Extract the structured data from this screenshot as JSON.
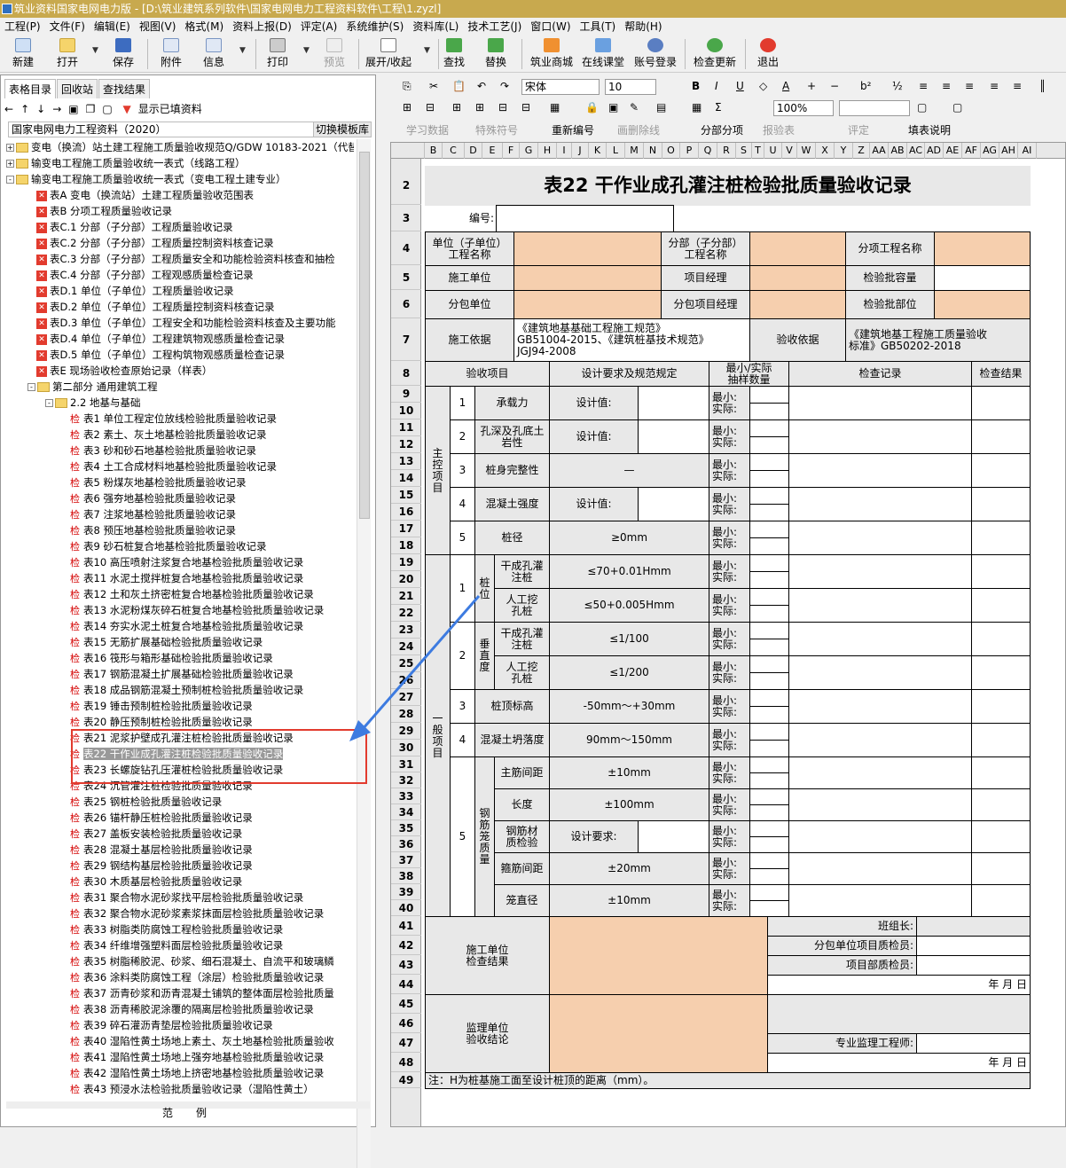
{
  "window": {
    "title": "筑业资料国家电网电力版 - [D:\\筑业建筑系列软件\\国家电网电力工程资料软件\\工程\\1.zyzl]"
  },
  "menu": [
    "工程(P)",
    "文件(F)",
    "编辑(E)",
    "视图(V)",
    "格式(M)",
    "资料上报(D)",
    "评定(A)",
    "系统维护(S)",
    "资料库(L)",
    "技术工艺(J)",
    "窗口(W)",
    "工具(T)",
    "帮助(H)"
  ],
  "toolbar": {
    "new": "新建",
    "open": "打开",
    "save": "保存",
    "attach": "附件",
    "info": "信息",
    "print": "打印",
    "preview": "预览",
    "expand": "展开/收起",
    "search": "查找",
    "replace": "替换",
    "mall": "筑业商城",
    "classroom": "在线课堂",
    "login": "账号登录",
    "update": "检查更新",
    "exit": "退出"
  },
  "left": {
    "tabs": [
      "表格目录",
      "回收站",
      "查找结果"
    ],
    "show_filled": "显示已填资料",
    "project": "国家电网电力工程资料（2020）",
    "switch_template": "切换模板库",
    "bottom": "范例"
  },
  "tree": [
    {
      "lv": 0,
      "t": "f",
      "ex": "+",
      "label": "变电（换流）站土建工程施工质量验收规范Q/GDW 10183-2021（代替"
    },
    {
      "lv": 0,
      "t": "f",
      "ex": "+",
      "label": "输变电工程施工质量验收统一表式（线路工程）"
    },
    {
      "lv": 0,
      "t": "f",
      "ex": "-",
      "label": "输变电工程施工质量验收统一表式（变电工程土建专业）"
    },
    {
      "lv": 1,
      "t": "x",
      "label": "表A 变电（换流站）土建工程质量验收范围表"
    },
    {
      "lv": 1,
      "t": "x",
      "label": "表B 分项工程质量验收记录"
    },
    {
      "lv": 1,
      "t": "x",
      "label": "表C.1 分部（子分部）工程质量验收记录"
    },
    {
      "lv": 1,
      "t": "x",
      "label": "表C.2 分部（子分部）工程质量控制资料核查记录"
    },
    {
      "lv": 1,
      "t": "x",
      "label": "表C.3 分部（子分部）工程质量安全和功能检验资料核查和抽检"
    },
    {
      "lv": 1,
      "t": "x",
      "label": "表C.4 分部（子分部）工程观感质量检查记录"
    },
    {
      "lv": 1,
      "t": "x",
      "label": "表D.1 单位（子单位）工程质量验收记录"
    },
    {
      "lv": 1,
      "t": "x",
      "label": "表D.2 单位（子单位）工程质量控制资料核查记录"
    },
    {
      "lv": 1,
      "t": "x",
      "label": "表D.3 单位（子单位）工程安全和功能检验资料核查及主要功能"
    },
    {
      "lv": 1,
      "t": "x",
      "label": "表D.4 单位（子单位）工程建筑物观感质量检查记录"
    },
    {
      "lv": 1,
      "t": "x",
      "label": "表D.5 单位（子单位）工程构筑物观感质量检查记录"
    },
    {
      "lv": 1,
      "t": "x",
      "label": "表E 现场验收检查原始记录（样表）"
    },
    {
      "lv": 1,
      "t": "f",
      "ex": "-",
      "label": "第二部分 通用建筑工程"
    },
    {
      "lv": 2,
      "t": "f",
      "ex": "-",
      "label": "2.2 地基与基础"
    },
    {
      "lv": 3,
      "t": "j",
      "label": "表1 单位工程定位放线检验批质量验收记录"
    },
    {
      "lv": 3,
      "t": "j",
      "label": "表2 素土、灰土地基检验批质量验收记录"
    },
    {
      "lv": 3,
      "t": "j",
      "label": "表3 砂和砂石地基检验批质量验收记录"
    },
    {
      "lv": 3,
      "t": "j",
      "label": "表4 土工合成材料地基检验批质量验收记录"
    },
    {
      "lv": 3,
      "t": "j",
      "label": "表5 粉煤灰地基检验批质量验收记录"
    },
    {
      "lv": 3,
      "t": "j",
      "label": "表6 强夯地基检验批质量验收记录"
    },
    {
      "lv": 3,
      "t": "j",
      "label": "表7 注浆地基检验批质量验收记录"
    },
    {
      "lv": 3,
      "t": "j",
      "label": "表8 预压地基检验批质量验收记录"
    },
    {
      "lv": 3,
      "t": "j",
      "label": "表9 砂石桩复合地基检验批质量验收记录"
    },
    {
      "lv": 3,
      "t": "j",
      "label": "表10 高压喷射注浆复合地基检验批质量验收记录"
    },
    {
      "lv": 3,
      "t": "j",
      "label": "表11 水泥土搅拌桩复合地基检验批质量验收记录"
    },
    {
      "lv": 3,
      "t": "j",
      "label": "表12 土和灰土挤密桩复合地基检验批质量验收记录"
    },
    {
      "lv": 3,
      "t": "j",
      "label": "表13 水泥粉煤灰碎石桩复合地基检验批质量验收记录"
    },
    {
      "lv": 3,
      "t": "j",
      "label": "表14 夯实水泥土桩复合地基检验批质量验收记录"
    },
    {
      "lv": 3,
      "t": "j",
      "label": "表15 无筋扩展基础检验批质量验收记录"
    },
    {
      "lv": 3,
      "t": "j",
      "label": "表16 筏形与箱形基础检验批质量验收记录"
    },
    {
      "lv": 3,
      "t": "j",
      "label": "表17 钢筋混凝土扩展基础检验批质量验收记录"
    },
    {
      "lv": 3,
      "t": "j",
      "label": "表18 成品钢筋混凝土预制桩检验批质量验收记录"
    },
    {
      "lv": 3,
      "t": "j",
      "label": "表19 锤击预制桩检验批质量验收记录"
    },
    {
      "lv": 3,
      "t": "j",
      "label": "表20 静压预制桩检验批质量验收记录"
    },
    {
      "lv": 3,
      "t": "j",
      "label": "表21 泥浆护壁成孔灌注桩检验批质量验收记录"
    },
    {
      "lv": 3,
      "t": "j",
      "sel": true,
      "label": "表22 干作业成孔灌注桩检验批质量验收记录"
    },
    {
      "lv": 3,
      "t": "j",
      "label": "表23 长螺旋钻孔压灌桩检验批质量验收记录"
    },
    {
      "lv": 3,
      "t": "j",
      "label": "表24 沉管灌注桩检验批质量验收记录"
    },
    {
      "lv": 3,
      "t": "j",
      "label": "表25 钢桩检验批质量验收记录"
    },
    {
      "lv": 3,
      "t": "j",
      "label": "表26 锚杆静压桩检验批质量验收记录"
    },
    {
      "lv": 3,
      "t": "j",
      "label": "表27 盖板安装检验批质量验收记录"
    },
    {
      "lv": 3,
      "t": "j",
      "label": "表28 混凝土基层检验批质量验收记录"
    },
    {
      "lv": 3,
      "t": "j",
      "label": "表29 钢结构基层检验批质量验收记录"
    },
    {
      "lv": 3,
      "t": "j",
      "label": "表30 木质基层检验批质量验收记录"
    },
    {
      "lv": 3,
      "t": "j",
      "label": "表31 聚合物水泥砂浆找平层检验批质量验收记录"
    },
    {
      "lv": 3,
      "t": "j",
      "label": "表32 聚合物水泥砂浆素浆抹面层检验批质量验收记录"
    },
    {
      "lv": 3,
      "t": "j",
      "label": "表33 树脂类防腐蚀工程检验批质量验收记录"
    },
    {
      "lv": 3,
      "t": "j",
      "label": "表34 纤维增强塑料面层检验批质量验收记录"
    },
    {
      "lv": 3,
      "t": "j",
      "label": "表35 树脂稀胶泥、砂浆、细石混凝土、自流平和玻璃鳞"
    },
    {
      "lv": 3,
      "t": "j",
      "label": "表36 涂料类防腐蚀工程（涂层）检验批质量验收记录"
    },
    {
      "lv": 3,
      "t": "j",
      "label": "表37 沥青砂浆和沥青混凝土铺筑的整体面层检验批质量"
    },
    {
      "lv": 3,
      "t": "j",
      "label": "表38 沥青稀胶泥涂覆的隔离层检验批质量验收记录"
    },
    {
      "lv": 3,
      "t": "j",
      "label": "表39 碎石灌沥青垫层检验批质量验收记录"
    },
    {
      "lv": 3,
      "t": "j",
      "label": "表40 湿陷性黄土场地上素土、灰土地基检验批质量验收"
    },
    {
      "lv": 3,
      "t": "j",
      "label": "表41 湿陷性黄土场地上强夯地基检验批质量验收记录"
    },
    {
      "lv": 3,
      "t": "j",
      "label": "表42 湿陷性黄土场地上挤密地基检验批质量验收记录"
    },
    {
      "lv": 3,
      "t": "j",
      "label": "表43 预浸水法检验批质量验收记录（湿陷性黄土）"
    }
  ],
  "format_toolbar": {
    "font": "宋体",
    "size": "10",
    "zoom": "100%",
    "row3": [
      "学习数据",
      "特殊符号",
      "重新编号",
      "画删除线",
      "分部分项",
      "报验表",
      "评定",
      "填表说明"
    ]
  },
  "sheet": {
    "cols": [
      "B",
      "C",
      "D",
      "E",
      "F",
      "G",
      "H",
      "I",
      "J",
      "K",
      "L",
      "M",
      "N",
      "O",
      "P",
      "Q",
      "R",
      "S",
      "T",
      "U",
      "V",
      "W",
      "X",
      "Y",
      "Z",
      "AA",
      "AB",
      "AC",
      "AD",
      "AE",
      "AF",
      "AG",
      "AH",
      "AI"
    ],
    "rows": [
      "2",
      "3",
      "4",
      "5",
      "6",
      "7",
      "8",
      "9",
      "10",
      "11",
      "12",
      "13",
      "14",
      "15",
      "16",
      "17",
      "18",
      "19",
      "20",
      "21",
      "22",
      "23",
      "24",
      "25",
      "26",
      "27",
      "28",
      "29",
      "30",
      "31",
      "32",
      "33",
      "34",
      "35",
      "36",
      "37",
      "38",
      "39",
      "40",
      "41",
      "42",
      "43",
      "44",
      "45",
      "46",
      "47",
      "48",
      "49"
    ],
    "title": "表22  干作业成孔灌注桩检验批质量验收记录",
    "number_label": "编号:",
    "unit_name": "单位（子单位）\n工程名称",
    "sub_name": "分部（子分部）\n工程名称",
    "item_name": "分项工程名称",
    "contractor": "施工单位",
    "pm": "项目经理",
    "batch_cap": "检验批容量",
    "sub_contractor": "分包单位",
    "sub_pm": "分包项目经理",
    "batch_loc": "检验批部位",
    "basis_label": "施工依据",
    "basis_value": "《建筑地基基础工程施工规范》\nGB51004-2015、《建筑桩基技术规范》\nJGJ94-2008",
    "acc_basis_label": "验收依据",
    "acc_basis_value": "《建筑地基工程施工质量验收\n标准》GB50202-2018",
    "h_item": "验收项目",
    "h_req": "设计要求及规范规定",
    "h_sample": "最小/实际\n抽样数量",
    "h_record": "检查记录",
    "h_result": "检查结果",
    "main_label": "主\n控\n项\n目",
    "general_label": "一\n般\n项\n目",
    "main_items": [
      {
        "no": "1",
        "name": "承载力",
        "req": "设计值:"
      },
      {
        "no": "2",
        "name": "孔深及孔底土\n岩性",
        "req": "设计值:"
      },
      {
        "no": "3",
        "name": "桩身完整性",
        "req": "—"
      },
      {
        "no": "4",
        "name": "混凝土强度",
        "req": "设计值:"
      },
      {
        "no": "5",
        "name": "桩径",
        "req": "≥0mm"
      }
    ],
    "gen": {
      "pos": "桩\n位",
      "vert": "垂\n直\n度",
      "pos_a": "干成孔灌\n注桩",
      "pos_a_req": "≤70+0.01Hmm",
      "pos_b": "人工挖\n孔桩",
      "pos_b_req": "≤50+0.005Hmm",
      "vert_a": "干成孔灌\n注桩",
      "vert_a_req": "≤1/100",
      "vert_b": "人工挖\n孔桩",
      "vert_b_req": "≤1/200",
      "top": "桩顶标高",
      "top_req": "-50mm～+30mm",
      "slump": "混凝土坍落度",
      "slump_req": "90mm～150mm",
      "cage": "钢\n筋\n笼\n质\n量",
      "main_bar": "主筋间距",
      "main_bar_req": "±10mm",
      "length": "长度",
      "length_req": "±100mm",
      "steel": "钢筋材\n质检验",
      "steel_req": "设计要求:",
      "stirrup": "箍筋间距",
      "stirrup_req": "±20mm",
      "dia": "笼直径",
      "dia_req": "±10mm"
    },
    "n1": "1",
    "n2": "2",
    "n3": "3",
    "n4": "4",
    "n5": "5",
    "min_actual": "最小:\n实际:",
    "contractor_result": "施工单位\n检查结果",
    "team_leader": "班组长:",
    "sub_qc": "分包单位项目质检员:",
    "dept_qc": "项目部质检员:",
    "date": "年   月   日",
    "supervisor_result": "监理单位\n验收结论",
    "supervisor": "专业监理工程师:",
    "note": "注：H为桩基施工面至设计桩顶的距离（mm）。"
  },
  "colors": {
    "title_bar": "#c8a94e",
    "input_fill": "#f6cfae",
    "label_fill": "#e8e8e8",
    "highlight": "#e23b2e",
    "arrow": "#3d7be0"
  }
}
